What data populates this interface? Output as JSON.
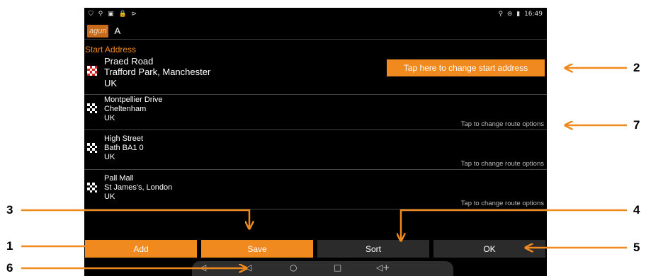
{
  "status_bar": {
    "left_icons": [
      "shield-icon",
      "person-icon",
      "image-icon",
      "lock-icon",
      "play-icon"
    ],
    "left_glyphs": [
      "⛉",
      "⚲",
      "▣",
      "🔒",
      "⊳"
    ],
    "right_glyphs": [
      "⚲",
      "⊜",
      "▮"
    ],
    "time": "16:49"
  },
  "title_bar": {
    "logo": "aguri",
    "title": "A"
  },
  "start_section_label": "Start Address",
  "change_start_button": "Tap here to change start address",
  "route_option_label": "Tap to change route options",
  "addresses": [
    {
      "lines": [
        "Praed Road",
        "Trafford Park, Manchester",
        "UK"
      ],
      "flag": "red-checkered-flag"
    },
    {
      "lines": [
        "Montpellier Drive",
        "Cheltenham",
        "UK"
      ],
      "flag": "checkered-flag"
    },
    {
      "lines": [
        "High Street",
        "Bath BA1 0",
        "UK"
      ],
      "flag": "checkered-flag"
    },
    {
      "lines": [
        "Pall Mall",
        "St James's, London",
        "UK"
      ],
      "flag": "checkered-flag"
    }
  ],
  "buttons": {
    "add": "Add",
    "save": "Save",
    "sort": "Sort",
    "ok": "OK"
  },
  "nav_bar": {
    "volume_down": "◁-",
    "back": "◁",
    "home": "○",
    "recents": "□",
    "volume_up": "◁+"
  },
  "callouts": [
    "1",
    "2",
    "3",
    "4",
    "5",
    "6",
    "7"
  ],
  "colors": {
    "accent": "#f08a1e",
    "background": "#000000",
    "button_dark": "#2b2b2b",
    "logo_bg": "#c66a1c"
  }
}
